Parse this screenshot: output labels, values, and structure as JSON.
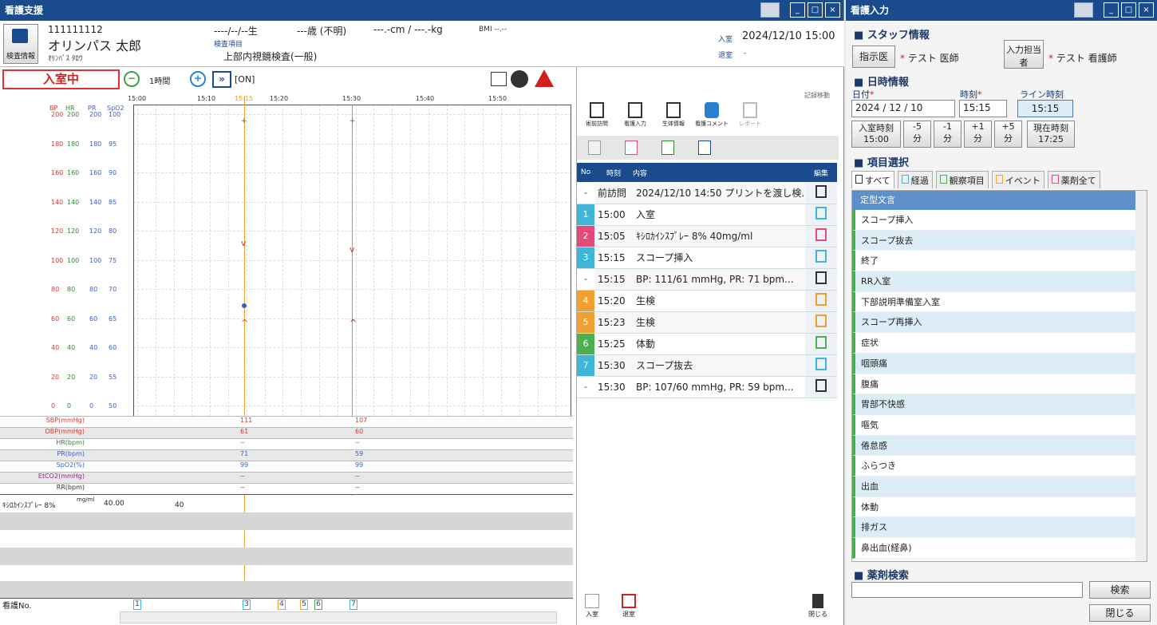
{
  "left": {
    "title": "看護支援",
    "patient": {
      "id": "111111112",
      "name": "オリンパス 太郎",
      "kana": "ｵﾘﾝﾊﾟｽ ﾀﾛｳ",
      "birth": "----/--/--生",
      "age": "---歳 (不明)",
      "size": "---.-cm / ---.-kg",
      "bmi": "BMI --.--",
      "exam_label": "検査項目",
      "exam": "上部内視鏡検査(一般)",
      "in_label": "入室",
      "in_time": "2024/12/10 15:00",
      "out_label": "退室",
      "out_time": "-",
      "info_btn": "検査情報"
    },
    "status": "入室中",
    "zoom": "1時間",
    "sync": "[ON]",
    "times": [
      "15:00",
      "15:10",
      "15:15",
      "15:20",
      "15:30",
      "15:40",
      "15:50"
    ],
    "axis_headers": [
      "BP",
      "HR",
      "PR",
      "SpO2"
    ],
    "y_rows": [
      [
        "200",
        "200",
        "200",
        "100"
      ],
      [
        "180",
        "180",
        "180",
        "95"
      ],
      [
        "160",
        "160",
        "160",
        "90"
      ],
      [
        "140",
        "140",
        "140",
        "85"
      ],
      [
        "120",
        "120",
        "120",
        "80"
      ],
      [
        "100",
        "100",
        "100",
        "75"
      ],
      [
        "80",
        "80",
        "80",
        "70"
      ],
      [
        "60",
        "60",
        "60",
        "65"
      ],
      [
        "40",
        "40",
        "40",
        "60"
      ],
      [
        "20",
        "20",
        "20",
        "55"
      ],
      [
        "0",
        "0",
        "0",
        "50"
      ]
    ],
    "vitals": [
      {
        "label": "SBP(mmHg)",
        "color": "#d33",
        "v1": "111",
        "v2": "107"
      },
      {
        "label": "DBP(mmHg)",
        "color": "#d33",
        "v1": "61",
        "v2": "60"
      },
      {
        "label": "HR(bpm)",
        "color": "#2a8a2a",
        "v1": "--",
        "v2": "--"
      },
      {
        "label": "PR(bpm)",
        "color": "#3a5ed0",
        "v1": "71",
        "v2": "59"
      },
      {
        "label": "SpO2(%)",
        "color": "#3a5ed0",
        "v1": "99",
        "v2": "99"
      },
      {
        "label": "EtCO2(mmHg)",
        "color": "#8a2a8a",
        "v1": "--",
        "v2": "--"
      },
      {
        "label": "RR(bpm)",
        "color": "#333",
        "v1": "--",
        "v2": "--"
      }
    ],
    "drug": {
      "name": "ｷｼﾛｶｲﾝｽﾌﾟﾚｰ 8%",
      "unit": "mg/ml",
      "dose": "40.00",
      "mark": "40"
    },
    "nurse_no": "看護No.",
    "markers": [
      "1",
      "3",
      "4",
      "5",
      "6",
      "7"
    ],
    "toolbar": {
      "move": "記録移動",
      "b1": "術前訪問",
      "b2": "看護入力",
      "b3": "生体情報",
      "b4": "看護コメント",
      "b5": "レポート"
    },
    "table_headers": [
      "No",
      "時刻",
      "内容",
      "編集"
    ],
    "records": [
      {
        "no": "-",
        "time": "前訪問",
        "text": "2024/12/10 14:50 プリントを渡し検...",
        "color": "#fff"
      },
      {
        "no": "1",
        "time": "15:00",
        "text": "入室",
        "color": "#3fb6d8"
      },
      {
        "no": "2",
        "time": "15:05",
        "text": "ｷｼﾛｶｲﾝｽﾌﾟﾚｰ 8% 40mg/ml",
        "color": "#e24a7a"
      },
      {
        "no": "3",
        "time": "15:15",
        "text": "スコープ挿入",
        "color": "#3fb6d8"
      },
      {
        "no": "-",
        "time": "15:15",
        "text": "BP: 111/61 mmHg, PR: 71 bpm...",
        "color": "#fff"
      },
      {
        "no": "4",
        "time": "15:20",
        "text": "生検",
        "color": "#f0a030"
      },
      {
        "no": "5",
        "time": "15:23",
        "text": "生検",
        "color": "#f0a030"
      },
      {
        "no": "6",
        "time": "15:25",
        "text": "体動",
        "color": "#4caf50"
      },
      {
        "no": "7",
        "time": "15:30",
        "text": "スコープ抜去",
        "color": "#3fb6d8"
      },
      {
        "no": "-",
        "time": "15:30",
        "text": "BP: 107/60 mmHg, PR: 59 bpm...",
        "color": "#fff"
      }
    ],
    "bottom": {
      "in": "入室",
      "out": "退室",
      "close": "閉じる"
    }
  },
  "right": {
    "title": "看護入力",
    "staff": {
      "section": "スタッフ情報",
      "b1": "指示医",
      "n1": "テスト 医師",
      "b2": "入力担当者",
      "n2": "テスト 看護師"
    },
    "dt": {
      "section": "日時情報",
      "date_label": "日付",
      "time_label": "時刻",
      "line_label": "ライン時刻",
      "date": "2024 / 12 / 10",
      "time": "15:15",
      "line": "15:15",
      "b_in": "入室時刻",
      "b_in_t": "15:00",
      "m5": "-5",
      "m1": "-1",
      "p1": "+1",
      "p5": "+5",
      "unit": "分",
      "now": "現在時刻",
      "now_t": "17:25"
    },
    "items": {
      "section": "項目選択",
      "tabs": [
        "すべて",
        "経過",
        "観察項目",
        "イベント",
        "薬剤全て"
      ],
      "list_header": "定型文言",
      "list": [
        "スコープ挿入",
        "スコープ抜去",
        "終了",
        "RR入室",
        "下部説明準備室入室",
        "スコープ再挿入",
        "症状",
        "咽頭痛",
        "腹痛",
        "胃部不快感",
        "嘔気",
        "倦怠感",
        "ふらつき",
        "出血",
        "体動",
        "排ガス",
        "鼻出血(経鼻)"
      ]
    },
    "drug": {
      "section": "薬剤検索",
      "search": "検索",
      "close": "閉じる"
    }
  }
}
